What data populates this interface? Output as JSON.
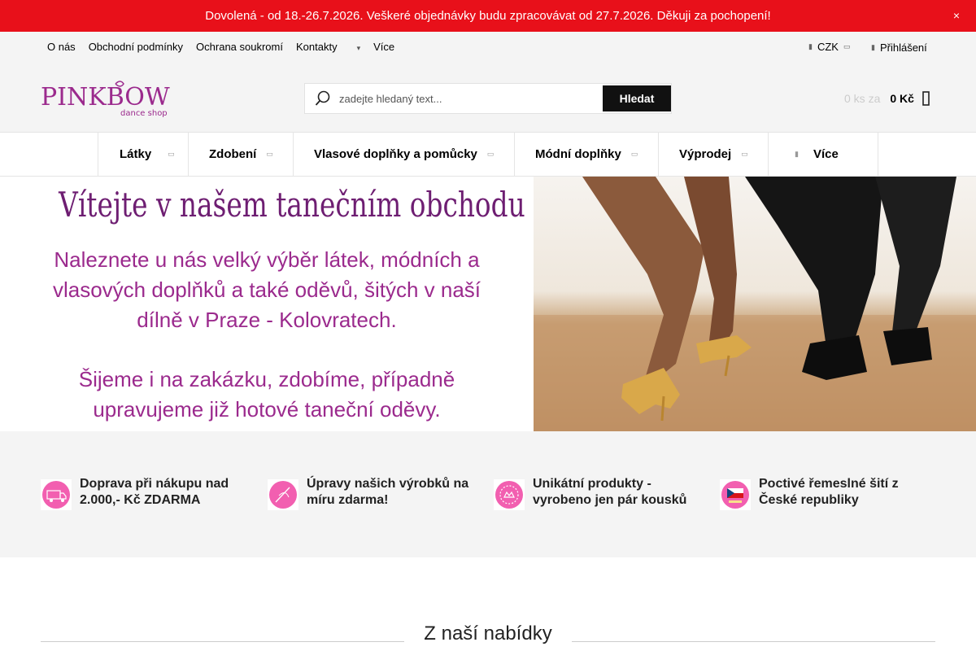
{
  "notice": {
    "text": "Dovolená - od 18.-26.7.2026. Veškeré objednávky budu zpracovávat od 27.7.2026. Děkuji za pochopení!",
    "close": "×"
  },
  "topbar": {
    "links": [
      "O nás",
      "Obchodní podmínky",
      "Ochrana soukromí",
      "Kontakty"
    ],
    "more": "Více",
    "currency": "CZK",
    "login": "Přihlášení"
  },
  "header": {
    "logo_text": "PINKBOW",
    "logo_sub": "dance shop",
    "search_placeholder": "zadejte hledaný text...",
    "search_button": "Hledat",
    "cart_count": "0 ks za",
    "cart_price": "0 Kč"
  },
  "nav": {
    "items": [
      "Látky",
      "Zdobení",
      "Vlasové doplňky a pomůcky",
      "Módní doplňky",
      "Výprodej",
      "Více"
    ]
  },
  "hero": {
    "title": "Vítejte v našem tanečním obchodu",
    "line1": "Naleznete u nás velký výběr látek, módních a",
    "line2": "vlasových doplňků a také oděvů, šitých v naší",
    "line3": "dílně v Praze - Kolovratech.",
    "line4": "Šijeme i na zakázku, zdobíme, případně",
    "line5": "upravujeme již hotové taneční oděvy."
  },
  "features": [
    {
      "text": "Doprava při nákupu nad 2.000,- Kč ZDARMA",
      "icon": "free-delivery-icon"
    },
    {
      "text": "Úpravy našich výrobků na míru zdarma!",
      "icon": "needle-icon"
    },
    {
      "text": "Unikátní produkty - vyrobeno jen pár kousků",
      "icon": "unique-badge-icon"
    },
    {
      "text": "Poctivé řemeslné šití z České republiky",
      "icon": "czech-flag-icon"
    }
  ],
  "section": {
    "title": "Z naší nabídky"
  },
  "colors": {
    "notice_bg": "#e8101a",
    "brand": "#9b2a8d",
    "accent_pink": "#f25fb0"
  }
}
